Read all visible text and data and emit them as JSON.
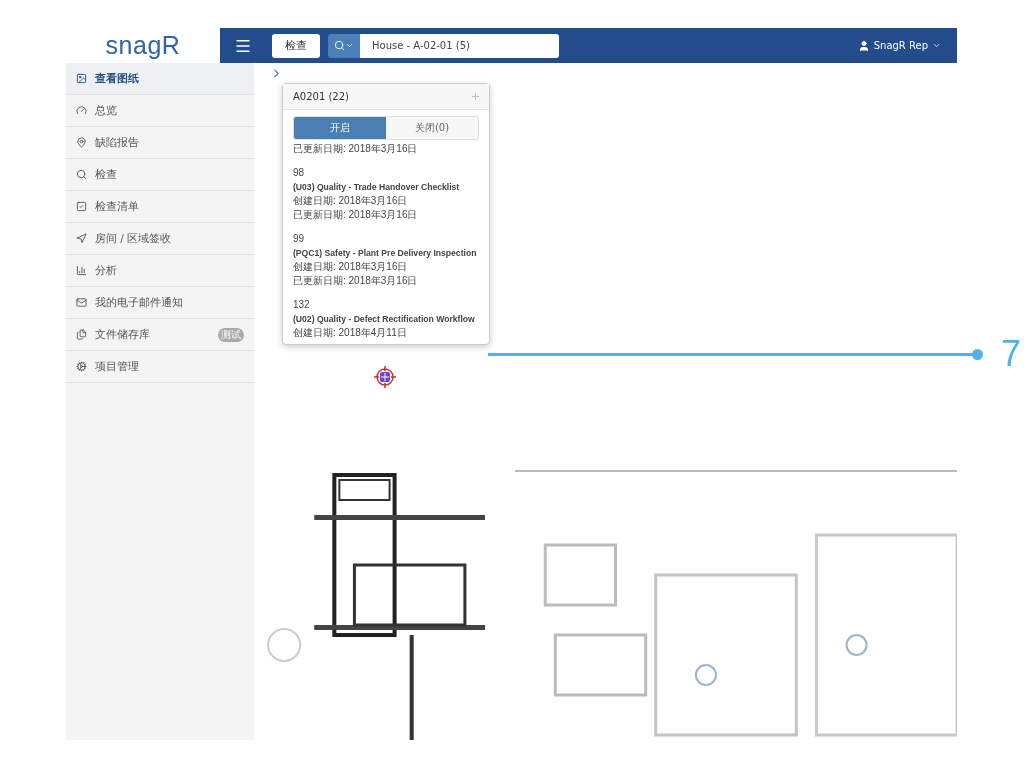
{
  "logo": "snagR",
  "header": {
    "scope_button": "检查",
    "search": {
      "value": "House - A-02-01 (5)"
    },
    "user": "SnagR Rep"
  },
  "sidebar": {
    "items": [
      {
        "label": "查看图纸",
        "selected": true
      },
      {
        "label": "总览",
        "selected": false
      },
      {
        "label": "缺陷报告",
        "selected": false
      },
      {
        "label": "检查",
        "selected": false
      },
      {
        "label": "检查清单",
        "selected": false
      },
      {
        "label": "房间 / 区域签收",
        "selected": false
      },
      {
        "label": "分析",
        "selected": false
      },
      {
        "label": "我的电子邮件通知",
        "selected": false
      },
      {
        "label": "文件储存库",
        "selected": false,
        "badge": "测试"
      },
      {
        "label": "项目管理",
        "selected": false
      }
    ]
  },
  "popup": {
    "title": "A0201 (22)",
    "tabs": [
      {
        "label": "开启",
        "selected": true
      },
      {
        "label": "关闭(0)",
        "selected": false
      }
    ],
    "entries": [
      {
        "lines": [
          "已更新日期: 2018年3月16日"
        ]
      },
      {
        "number": "98",
        "title": "(U03) Quality - Trade Handover Checklist",
        "lines": [
          "创建日期: 2018年3月16日",
          "已更新日期: 2018年3月16日"
        ]
      },
      {
        "number": "99",
        "title": "(PQC1) Safety - Plant Pre Delivery Inspection",
        "lines": [
          "创建日期: 2018年3月16日",
          "已更新日期: 2018年3月16日"
        ]
      },
      {
        "number": "132",
        "title": "(U02) Quality - Defect Rectification Workflow",
        "lines": [
          "创建日期: 2018年4月11日"
        ]
      }
    ]
  },
  "callout": {
    "label": "7"
  }
}
